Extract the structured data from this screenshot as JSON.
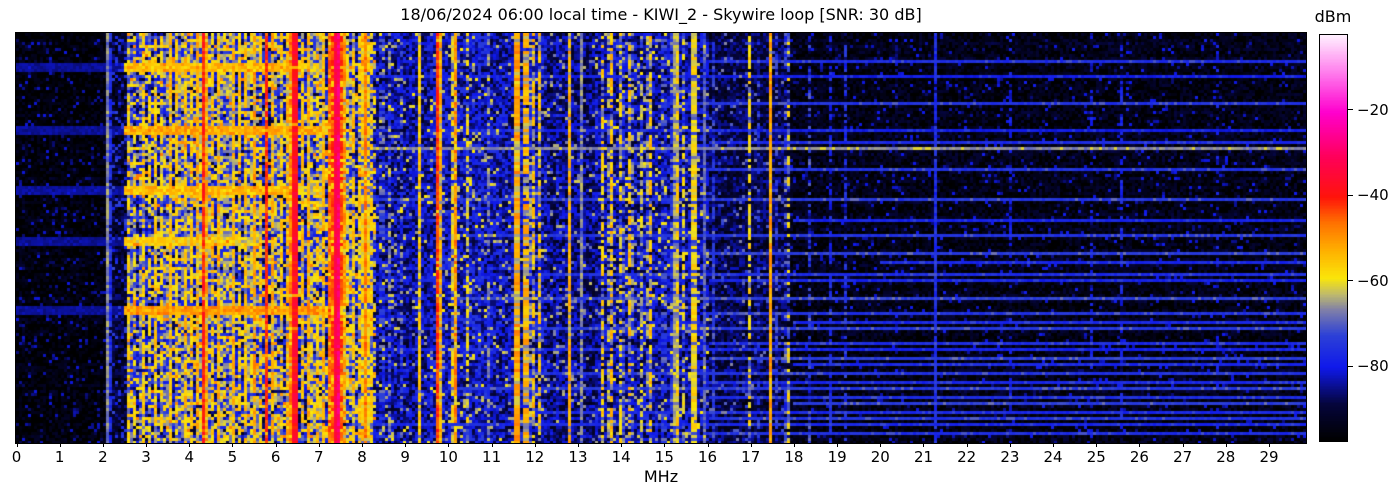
{
  "chart_data": {
    "type": "heatmap",
    "subtype": "hf-radio-spectrogram-waterfall",
    "title": "18/06/2024 06:00 local time - KIWI_2 - Skywire loop [SNR: 30 dB]",
    "station": "KIWI_2",
    "antenna": "Skywire loop",
    "snr_db": 30,
    "datetime_label": "18/06/2024 06:00 local time",
    "xlabel": "MHz",
    "x_range": [
      0,
      29.86
    ],
    "x_ticks": [
      0,
      1,
      2,
      3,
      4,
      5,
      6,
      7,
      8,
      9,
      10,
      11,
      12,
      13,
      14,
      15,
      16,
      17,
      18,
      19,
      20,
      21,
      22,
      23,
      24,
      25,
      26,
      27,
      28,
      29
    ],
    "y_axis": "time (no labels shown)",
    "colorbar": {
      "label": "dBm",
      "tick_values": [
        -20,
        -40,
        -60,
        -80
      ],
      "tick_labels": [
        "−20",
        "−40",
        "−60",
        "−80"
      ],
      "vmin": -97.5,
      "vmax": -2.5
    },
    "colormap_stops": [
      [
        0.0,
        [
          0,
          0,
          0
        ]
      ],
      [
        0.09,
        [
          5,
          5,
          60
        ]
      ],
      [
        0.18,
        [
          15,
          25,
          235
        ]
      ],
      [
        0.26,
        [
          45,
          65,
          215
        ]
      ],
      [
        0.32,
        [
          125,
          125,
          170
        ]
      ],
      [
        0.36,
        [
          190,
          185,
          110
        ]
      ],
      [
        0.4,
        [
          250,
          230,
          10
        ]
      ],
      [
        0.47,
        [
          255,
          175,
          0
        ]
      ],
      [
        0.54,
        [
          255,
          110,
          0
        ]
      ],
      [
        0.6,
        [
          255,
          20,
          10
        ]
      ],
      [
        0.7,
        [
          255,
          0,
          90
        ]
      ],
      [
        0.81,
        [
          255,
          0,
          205
        ]
      ],
      [
        0.9,
        [
          255,
          115,
          235
        ]
      ],
      [
        1.0,
        [
          255,
          240,
          255
        ]
      ]
    ],
    "noise_bands_format": "[f_max_mhz, floor_dbm, variation_db, speckle_prob, speckle_dbm]",
    "noise_bands": [
      [
        2.05,
        -96,
        4,
        0.1,
        -85
      ],
      [
        2.55,
        -91,
        6,
        0.12,
        -76
      ],
      [
        8.35,
        -82,
        10,
        0.22,
        -59
      ],
      [
        9.6,
        -84,
        8,
        0.08,
        -63
      ],
      [
        10.9,
        -82,
        8,
        0.1,
        -63
      ],
      [
        12.25,
        -83,
        8,
        0.08,
        -64
      ],
      [
        13.4,
        -86,
        7,
        0.06,
        -66
      ],
      [
        16.0,
        -84,
        8,
        0.09,
        -63
      ],
      [
        17.9,
        -89,
        6,
        0.05,
        -70
      ],
      [
        30.0,
        -94.5,
        5,
        0.06,
        -83
      ]
    ],
    "signals_format": "[freq_mhz, width_mhz, level_dbm, persistence_0_to_1]",
    "signals": [
      [
        2.13,
        0.05,
        -67,
        1.0
      ],
      [
        2.62,
        0.06,
        -58,
        0.6
      ],
      [
        2.75,
        0.05,
        -60,
        0.5
      ],
      [
        2.92,
        0.06,
        -57,
        0.6
      ],
      [
        3.08,
        0.05,
        -59,
        0.5
      ],
      [
        3.22,
        0.07,
        -56,
        0.65
      ],
      [
        3.38,
        0.06,
        -58,
        0.55
      ],
      [
        3.55,
        0.07,
        -55,
        0.7
      ],
      [
        3.72,
        0.06,
        -57,
        0.6
      ],
      [
        3.88,
        0.07,
        -55,
        0.65
      ],
      [
        4.03,
        0.06,
        -56,
        0.6
      ],
      [
        4.2,
        0.07,
        -52,
        0.7
      ],
      [
        4.35,
        0.08,
        -41,
        0.95
      ],
      [
        4.52,
        0.06,
        -56,
        0.6
      ],
      [
        4.68,
        0.07,
        -54,
        0.65
      ],
      [
        4.85,
        0.06,
        -57,
        0.55
      ],
      [
        5.0,
        0.07,
        -54,
        0.7
      ],
      [
        5.17,
        0.06,
        -57,
        0.55
      ],
      [
        5.32,
        0.07,
        -55,
        0.6
      ],
      [
        5.48,
        0.07,
        -51,
        0.65
      ],
      [
        5.62,
        0.06,
        -57,
        0.5
      ],
      [
        5.79,
        0.05,
        -42,
        0.95
      ],
      [
        5.96,
        0.07,
        -52,
        0.65
      ],
      [
        6.12,
        0.06,
        -56,
        0.55
      ],
      [
        6.28,
        0.07,
        -54,
        0.6
      ],
      [
        6.43,
        0.11,
        -38,
        0.97
      ],
      [
        6.62,
        0.06,
        -55,
        0.6
      ],
      [
        6.78,
        0.07,
        -53,
        0.65
      ],
      [
        6.95,
        0.06,
        -56,
        0.55
      ],
      [
        7.1,
        0.07,
        -54,
        0.6
      ],
      [
        7.25,
        0.07,
        -46,
        0.8
      ],
      [
        7.43,
        0.14,
        -34,
        1.0
      ],
      [
        7.44,
        0.04,
        -29,
        0.9
      ],
      [
        7.62,
        0.07,
        -50,
        0.7
      ],
      [
        7.78,
        0.06,
        -55,
        0.6
      ],
      [
        7.95,
        0.06,
        -56,
        0.55
      ],
      [
        8.07,
        0.09,
        -48,
        0.9
      ],
      [
        8.22,
        0.06,
        -57,
        0.5
      ],
      [
        8.46,
        0.06,
        -61,
        0.4
      ],
      [
        8.62,
        0.05,
        -66,
        0.45
      ],
      [
        8.9,
        0.05,
        -70,
        0.4
      ],
      [
        9.32,
        0.05,
        -56,
        0.85
      ],
      [
        9.77,
        0.06,
        -43,
        0.95
      ],
      [
        10.15,
        0.07,
        -49,
        0.7
      ],
      [
        10.45,
        0.06,
        -60,
        0.4
      ],
      [
        10.7,
        0.04,
        -68,
        0.6
      ],
      [
        10.92,
        0.04,
        -66,
        0.5
      ],
      [
        11.59,
        0.05,
        -41,
        0.95
      ],
      [
        11.8,
        0.1,
        -53,
        0.55
      ],
      [
        11.95,
        0.08,
        -55,
        0.5
      ],
      [
        12.1,
        0.06,
        -55,
        0.55
      ],
      [
        12.5,
        0.04,
        -68,
        0.4
      ],
      [
        12.79,
        0.05,
        -53,
        0.8
      ],
      [
        13.1,
        0.04,
        -67,
        0.9
      ],
      [
        13.58,
        0.06,
        -57,
        0.5
      ],
      [
        13.76,
        0.06,
        -55,
        0.55
      ],
      [
        14.0,
        0.06,
        -58,
        0.45
      ],
      [
        14.22,
        0.06,
        -55,
        0.5
      ],
      [
        14.48,
        0.05,
        -62,
        0.4
      ],
      [
        14.65,
        0.06,
        -55,
        0.5
      ],
      [
        15.0,
        0.05,
        -62,
        0.4
      ],
      [
        15.25,
        0.12,
        -65,
        0.9
      ],
      [
        15.3,
        0.05,
        -57,
        0.45
      ],
      [
        15.45,
        0.05,
        -60,
        0.35
      ],
      [
        15.69,
        0.06,
        -49,
        0.97
      ],
      [
        15.92,
        0.04,
        -70,
        0.9
      ],
      [
        16.12,
        0.04,
        -73,
        0.6
      ],
      [
        16.95,
        0.05,
        -58,
        0.5
      ],
      [
        17.15,
        0.04,
        -64,
        0.4
      ],
      [
        17.47,
        0.05,
        -52,
        0.9
      ],
      [
        17.62,
        0.04,
        -63,
        0.5
      ],
      [
        17.85,
        0.05,
        -59,
        0.35
      ],
      [
        18.35,
        0.04,
        -72,
        0.35
      ],
      [
        18.86,
        0.04,
        -78,
        0.6
      ],
      [
        19.2,
        0.04,
        -76,
        0.45
      ],
      [
        20.4,
        0.04,
        -79,
        0.4
      ],
      [
        21.3,
        0.05,
        -77,
        0.95
      ],
      [
        23.0,
        0.04,
        -81,
        0.4
      ],
      [
        24.9,
        0.04,
        -81,
        0.35
      ],
      [
        25.6,
        0.04,
        -79,
        0.5
      ],
      [
        27.8,
        0.04,
        -81,
        0.3
      ]
    ],
    "time_bursts_format": "[y_fraction_of_plot, f_hi_mhz, level_dbm] broadband bursts 2.55 MHz upward",
    "time_bursts": [
      [
        0.083,
        7.0,
        -55
      ],
      [
        0.234,
        7.6,
        -53
      ],
      [
        0.378,
        6.8,
        -55
      ],
      [
        0.507,
        5.6,
        -58
      ],
      [
        0.673,
        7.5,
        -51
      ]
    ],
    "horizontal_streaks_format": "[y_fraction_of_plot, f_lo_mhz, level_dbm] faint ionospheric lines to 29.9 MHz",
    "horizontal_streaks": [
      [
        0.068,
        16,
        -77
      ],
      [
        0.1,
        2.6,
        -80
      ],
      [
        0.168,
        15,
        -76
      ],
      [
        0.235,
        10,
        -80
      ],
      [
        0.26,
        16,
        -78
      ],
      [
        0.281,
        7.9,
        -67
      ],
      [
        0.33,
        16,
        -76
      ],
      [
        0.4,
        8,
        -75
      ],
      [
        0.45,
        18,
        -79
      ],
      [
        0.487,
        10,
        -76
      ],
      [
        0.53,
        16,
        -74
      ],
      [
        0.558,
        20,
        -78
      ],
      [
        0.585,
        12,
        -77
      ],
      [
        0.6,
        16,
        -79
      ],
      [
        0.641,
        10,
        -74
      ],
      [
        0.676,
        16,
        -76
      ],
      [
        0.7,
        18,
        -78
      ],
      [
        0.715,
        12,
        -75
      ],
      [
        0.75,
        16,
        -77
      ],
      [
        0.77,
        8,
        -79
      ],
      [
        0.788,
        16,
        -74
      ],
      [
        0.806,
        18,
        -78
      ],
      [
        0.824,
        12,
        -76
      ],
      [
        0.845,
        16,
        -78
      ],
      [
        0.862,
        10,
        -75
      ],
      [
        0.88,
        16,
        -77
      ],
      [
        0.898,
        18,
        -74
      ],
      [
        0.917,
        12,
        -78
      ],
      [
        0.935,
        16,
        -76
      ],
      [
        0.952,
        8,
        -78
      ],
      [
        0.97,
        16,
        -77
      ]
    ]
  }
}
